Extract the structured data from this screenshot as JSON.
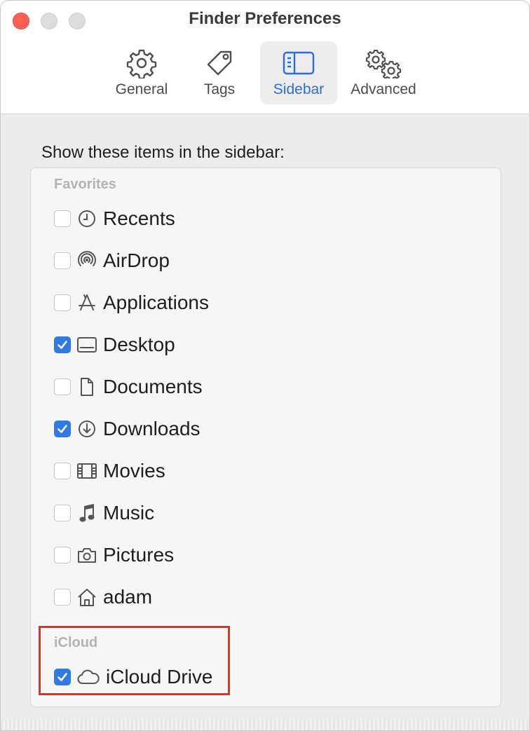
{
  "window": {
    "title": "Finder Preferences"
  },
  "toolbar": {
    "tabs": [
      {
        "label": "General",
        "icon": "gear-icon"
      },
      {
        "label": "Tags",
        "icon": "tag-icon"
      },
      {
        "label": "Sidebar",
        "icon": "sidebar-icon",
        "selected": true
      },
      {
        "label": "Advanced",
        "icon": "gears-icon"
      }
    ]
  },
  "main": {
    "heading": "Show these items in the sidebar:",
    "sections": [
      {
        "title": "Favorites",
        "items": [
          {
            "label": "Recents",
            "checked": false,
            "icon": "clock-icon"
          },
          {
            "label": "AirDrop",
            "checked": false,
            "icon": "airdrop-icon"
          },
          {
            "label": "Applications",
            "checked": false,
            "icon": "applications-icon"
          },
          {
            "label": "Desktop",
            "checked": true,
            "icon": "desktop-icon"
          },
          {
            "label": "Documents",
            "checked": false,
            "icon": "document-icon"
          },
          {
            "label": "Downloads",
            "checked": true,
            "icon": "download-icon"
          },
          {
            "label": "Movies",
            "checked": false,
            "icon": "film-icon"
          },
          {
            "label": "Music",
            "checked": false,
            "icon": "music-note-icon"
          },
          {
            "label": "Pictures",
            "checked": false,
            "icon": "camera-icon"
          },
          {
            "label": "adam",
            "checked": false,
            "icon": "home-icon"
          }
        ]
      },
      {
        "title": "iCloud",
        "items": [
          {
            "label": "iCloud Drive",
            "checked": true,
            "icon": "cloud-icon"
          }
        ]
      }
    ]
  },
  "colors": {
    "accent": "#2f7ae5",
    "highlight": "#e8301b",
    "close": "#ff5f57"
  }
}
